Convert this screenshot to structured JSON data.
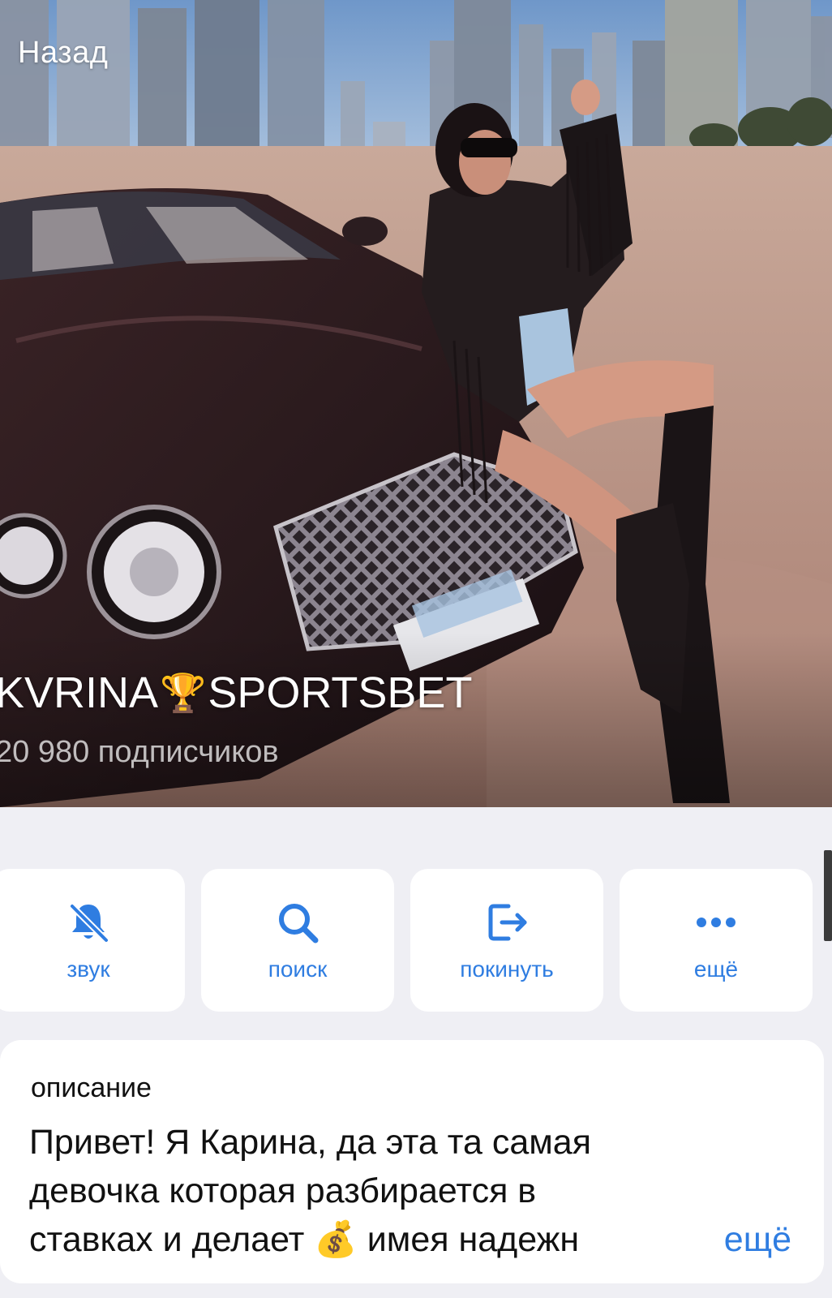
{
  "header": {
    "back_label": "Назад"
  },
  "channel": {
    "name_part1": "KVRINA",
    "name_emoji": "🏆",
    "name_part2": "SPORTSBET",
    "subscribers": "20 980 подписчиков"
  },
  "actions": [
    {
      "label": "звук",
      "icon": "bell-muted-icon"
    },
    {
      "label": "поиск",
      "icon": "search-icon"
    },
    {
      "label": "покинуть",
      "icon": "leave-icon"
    },
    {
      "label": "ещё",
      "icon": "more-dots-icon"
    }
  ],
  "description": {
    "title": "описание",
    "lines": [
      "Привет! Я Карина, да эта та самая",
      "девочка которая разбирается в",
      "ставках и делает 💰 имея надежн"
    ],
    "more_label": "ещё"
  },
  "colors": {
    "accent": "#2f7de1",
    "background": "#efeff4",
    "card": "#ffffff"
  }
}
